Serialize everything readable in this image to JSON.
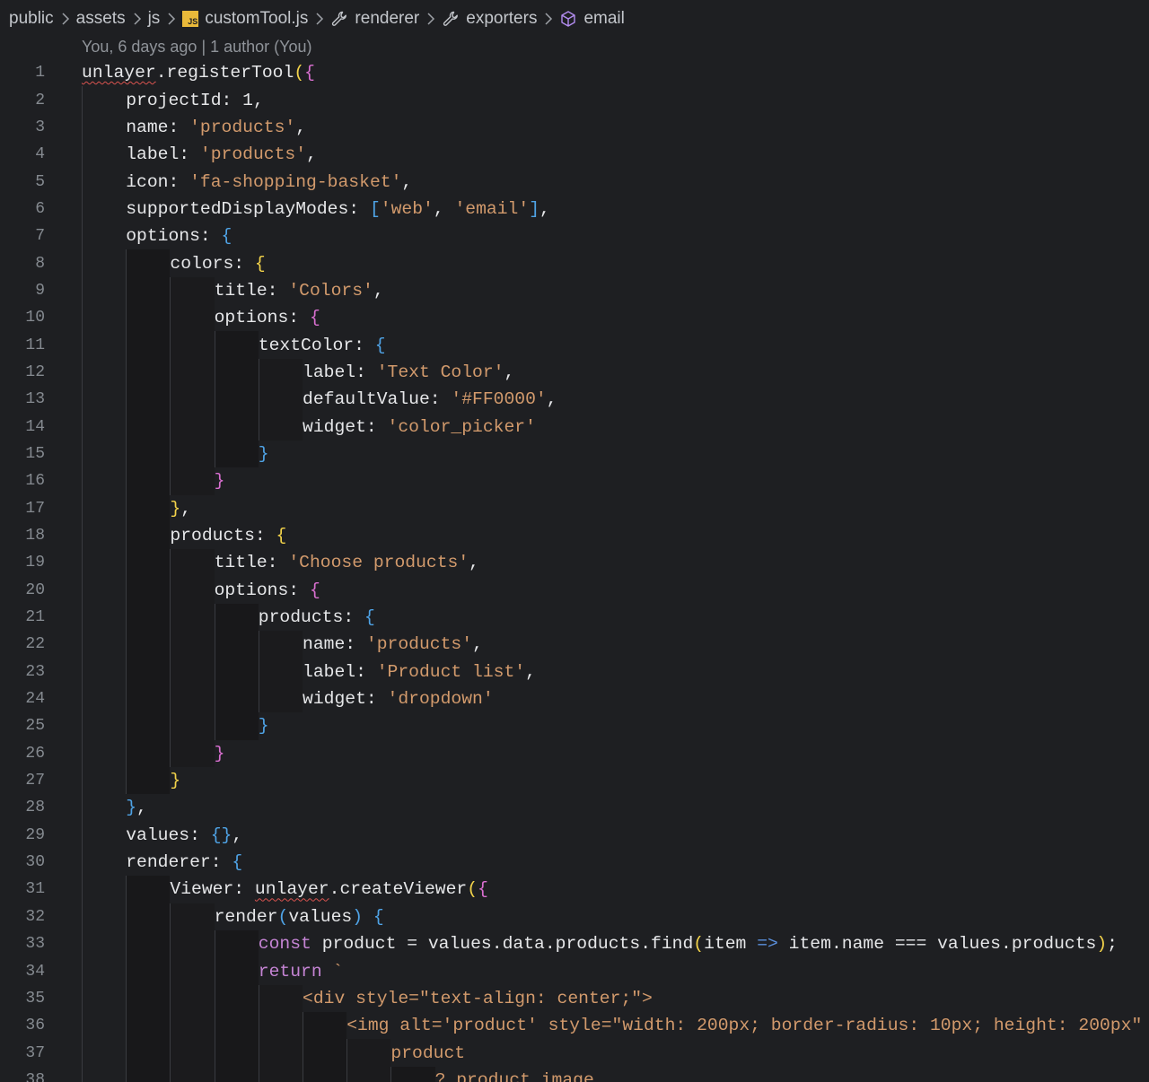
{
  "breadcrumb": [
    {
      "label": "public",
      "icon": ""
    },
    {
      "label": "assets",
      "icon": ""
    },
    {
      "label": "js",
      "icon": ""
    },
    {
      "label": "customTool.js",
      "icon": "js-file-icon",
      "badge": "JS"
    },
    {
      "label": "renderer",
      "icon": "wrench-icon"
    },
    {
      "label": "exporters",
      "icon": "wrench-icon"
    },
    {
      "label": "email",
      "icon": "cube-icon"
    }
  ],
  "blame": "You, 6 days ago | 1 author (You)",
  "lines": [
    {
      "n": "1",
      "indent": 0,
      "tokens": [
        [
          "id squiggle",
          "unlayer"
        ],
        [
          "punc",
          "."
        ],
        [
          "fn",
          "registerTool"
        ],
        [
          "b1",
          "("
        ],
        [
          "b2",
          "{"
        ]
      ]
    },
    {
      "n": "2",
      "indent": 1,
      "tokens": [
        [
          "prop",
          "projectId"
        ],
        [
          "punc",
          ": "
        ],
        [
          "num",
          "1"
        ],
        [
          "punc",
          ","
        ]
      ]
    },
    {
      "n": "3",
      "indent": 1,
      "tokens": [
        [
          "prop",
          "name"
        ],
        [
          "punc",
          ": "
        ],
        [
          "str",
          "'products'"
        ],
        [
          "punc",
          ","
        ]
      ]
    },
    {
      "n": "4",
      "indent": 1,
      "tokens": [
        [
          "prop",
          "label"
        ],
        [
          "punc",
          ": "
        ],
        [
          "str",
          "'products'"
        ],
        [
          "punc",
          ","
        ]
      ]
    },
    {
      "n": "5",
      "indent": 1,
      "tokens": [
        [
          "prop",
          "icon"
        ],
        [
          "punc",
          ": "
        ],
        [
          "str",
          "'fa-shopping-basket'"
        ],
        [
          "punc",
          ","
        ]
      ]
    },
    {
      "n": "6",
      "indent": 1,
      "tokens": [
        [
          "prop",
          "supportedDisplayModes"
        ],
        [
          "punc",
          ": "
        ],
        [
          "b3",
          "["
        ],
        [
          "str",
          "'web'"
        ],
        [
          "punc",
          ", "
        ],
        [
          "str",
          "'email'"
        ],
        [
          "b3",
          "]"
        ],
        [
          "punc",
          ","
        ]
      ]
    },
    {
      "n": "7",
      "indent": 1,
      "tokens": [
        [
          "prop",
          "options"
        ],
        [
          "punc",
          ": "
        ],
        [
          "b3",
          "{"
        ]
      ]
    },
    {
      "n": "8",
      "indent": 2,
      "tokens": [
        [
          "prop",
          "colors"
        ],
        [
          "punc",
          ": "
        ],
        [
          "b1",
          "{"
        ]
      ]
    },
    {
      "n": "9",
      "indent": 3,
      "tokens": [
        [
          "prop",
          "title"
        ],
        [
          "punc",
          ": "
        ],
        [
          "str",
          "'Colors'"
        ],
        [
          "punc",
          ","
        ]
      ]
    },
    {
      "n": "10",
      "indent": 3,
      "tokens": [
        [
          "prop",
          "options"
        ],
        [
          "punc",
          ": "
        ],
        [
          "b2",
          "{"
        ]
      ]
    },
    {
      "n": "11",
      "indent": 4,
      "tokens": [
        [
          "prop",
          "textColor"
        ],
        [
          "punc",
          ": "
        ],
        [
          "b3",
          "{"
        ]
      ]
    },
    {
      "n": "12",
      "indent": 5,
      "tokens": [
        [
          "prop",
          "label"
        ],
        [
          "punc",
          ": "
        ],
        [
          "str",
          "'Text Color'"
        ],
        [
          "punc",
          ","
        ]
      ]
    },
    {
      "n": "13",
      "indent": 5,
      "tokens": [
        [
          "prop",
          "defaultValue"
        ],
        [
          "punc",
          ": "
        ],
        [
          "str",
          "'#FF0000'"
        ],
        [
          "punc",
          ","
        ]
      ]
    },
    {
      "n": "14",
      "indent": 5,
      "tokens": [
        [
          "prop",
          "widget"
        ],
        [
          "punc",
          ": "
        ],
        [
          "str",
          "'color_picker'"
        ]
      ]
    },
    {
      "n": "15",
      "indent": 4,
      "tokens": [
        [
          "b3",
          "}"
        ]
      ]
    },
    {
      "n": "16",
      "indent": 3,
      "tokens": [
        [
          "b2",
          "}"
        ]
      ]
    },
    {
      "n": "17",
      "indent": 2,
      "tokens": [
        [
          "b1",
          "}"
        ],
        [
          "punc",
          ","
        ]
      ]
    },
    {
      "n": "18",
      "indent": 2,
      "tokens": [
        [
          "prop",
          "products"
        ],
        [
          "punc",
          ": "
        ],
        [
          "b1",
          "{"
        ]
      ]
    },
    {
      "n": "19",
      "indent": 3,
      "tokens": [
        [
          "prop",
          "title"
        ],
        [
          "punc",
          ": "
        ],
        [
          "str",
          "'Choose products'"
        ],
        [
          "punc",
          ","
        ]
      ]
    },
    {
      "n": "20",
      "indent": 3,
      "tokens": [
        [
          "prop",
          "options"
        ],
        [
          "punc",
          ": "
        ],
        [
          "b2",
          "{"
        ]
      ]
    },
    {
      "n": "21",
      "indent": 4,
      "tokens": [
        [
          "prop",
          "products"
        ],
        [
          "punc",
          ": "
        ],
        [
          "b3",
          "{"
        ]
      ]
    },
    {
      "n": "22",
      "indent": 5,
      "tokens": [
        [
          "prop",
          "name"
        ],
        [
          "punc",
          ": "
        ],
        [
          "str",
          "'products'"
        ],
        [
          "punc",
          ","
        ]
      ]
    },
    {
      "n": "23",
      "indent": 5,
      "tokens": [
        [
          "prop",
          "label"
        ],
        [
          "punc",
          ": "
        ],
        [
          "str",
          "'Product list'"
        ],
        [
          "punc",
          ","
        ]
      ]
    },
    {
      "n": "24",
      "indent": 5,
      "tokens": [
        [
          "prop",
          "widget"
        ],
        [
          "punc",
          ": "
        ],
        [
          "str",
          "'dropdown'"
        ]
      ]
    },
    {
      "n": "25",
      "indent": 4,
      "tokens": [
        [
          "b3",
          "}"
        ]
      ]
    },
    {
      "n": "26",
      "indent": 3,
      "tokens": [
        [
          "b2",
          "}"
        ]
      ]
    },
    {
      "n": "27",
      "indent": 2,
      "tokens": [
        [
          "b1",
          "}"
        ]
      ]
    },
    {
      "n": "28",
      "indent": 1,
      "tokens": [
        [
          "b3",
          "}"
        ],
        [
          "punc",
          ","
        ]
      ]
    },
    {
      "n": "29",
      "indent": 1,
      "tokens": [
        [
          "prop",
          "values"
        ],
        [
          "punc",
          ": "
        ],
        [
          "b3",
          "{}"
        ],
        [
          "punc",
          ","
        ]
      ]
    },
    {
      "n": "30",
      "indent": 1,
      "tokens": [
        [
          "prop",
          "renderer"
        ],
        [
          "punc",
          ": "
        ],
        [
          "b3",
          "{"
        ]
      ]
    },
    {
      "n": "31",
      "indent": 2,
      "tokens": [
        [
          "prop",
          "Viewer"
        ],
        [
          "punc",
          ": "
        ],
        [
          "id squiggle",
          "unlayer"
        ],
        [
          "punc",
          "."
        ],
        [
          "fn",
          "createViewer"
        ],
        [
          "b1",
          "("
        ],
        [
          "b2",
          "{"
        ]
      ]
    },
    {
      "n": "32",
      "indent": 3,
      "tokens": [
        [
          "fn",
          "render"
        ],
        [
          "b3",
          "("
        ],
        [
          "id",
          "values"
        ],
        [
          "b3",
          ")"
        ],
        [
          "punc",
          " "
        ],
        [
          "b3",
          "{"
        ]
      ]
    },
    {
      "n": "33",
      "indent": 4,
      "tokens": [
        [
          "kw",
          "const"
        ],
        [
          "punc",
          " "
        ],
        [
          "id",
          "product"
        ],
        [
          "punc",
          " = "
        ],
        [
          "id",
          "values"
        ],
        [
          "punc",
          "."
        ],
        [
          "id",
          "data"
        ],
        [
          "punc",
          "."
        ],
        [
          "id",
          "products"
        ],
        [
          "punc",
          "."
        ],
        [
          "fn",
          "find"
        ],
        [
          "b1",
          "("
        ],
        [
          "id",
          "item"
        ],
        [
          "punc",
          " "
        ],
        [
          "arrow",
          "=>"
        ],
        [
          "punc",
          " "
        ],
        [
          "id",
          "item"
        ],
        [
          "punc",
          "."
        ],
        [
          "id",
          "name"
        ],
        [
          "punc",
          " === "
        ],
        [
          "id",
          "values"
        ],
        [
          "punc",
          "."
        ],
        [
          "id",
          "products"
        ],
        [
          "b1",
          ")"
        ],
        [
          "punc",
          ";"
        ]
      ]
    },
    {
      "n": "34",
      "indent": 4,
      "tokens": [
        [
          "kw",
          "return"
        ],
        [
          "punc",
          " "
        ],
        [
          "tmpl",
          "`"
        ]
      ]
    },
    {
      "n": "35",
      "indent": 5,
      "tokens": [
        [
          "tmpl",
          "<div style=\"text-align: center;\">"
        ]
      ]
    },
    {
      "n": "36",
      "indent": 6,
      "tokens": [
        [
          "tmpl",
          "<img alt='product' style=\"width: 200px; border-radius: 10px; height: 200px\""
        ]
      ]
    },
    {
      "n": "37",
      "indent": 7,
      "tokens": [
        [
          "tmpl",
          "product"
        ]
      ]
    },
    {
      "n": "38",
      "indent": 8,
      "tokens": [
        [
          "tmpl",
          "? product.image"
        ]
      ]
    }
  ]
}
